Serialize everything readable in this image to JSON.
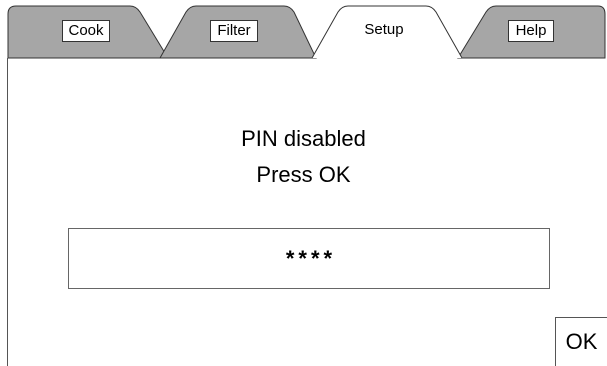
{
  "tabs": [
    {
      "label": "Cook",
      "active": false
    },
    {
      "label": "Filter",
      "active": false
    },
    {
      "label": "Setup",
      "active": true
    },
    {
      "label": "Help",
      "active": false
    }
  ],
  "message": {
    "line1": "PIN disabled",
    "line2": "Press OK"
  },
  "pin": {
    "value": "****"
  },
  "ok_button": {
    "label": "OK"
  },
  "colors": {
    "inactive_tab_fill": "#a6a6a6",
    "active_tab_fill": "#ffffff",
    "outline": "#333333",
    "background": "#ffffff"
  }
}
